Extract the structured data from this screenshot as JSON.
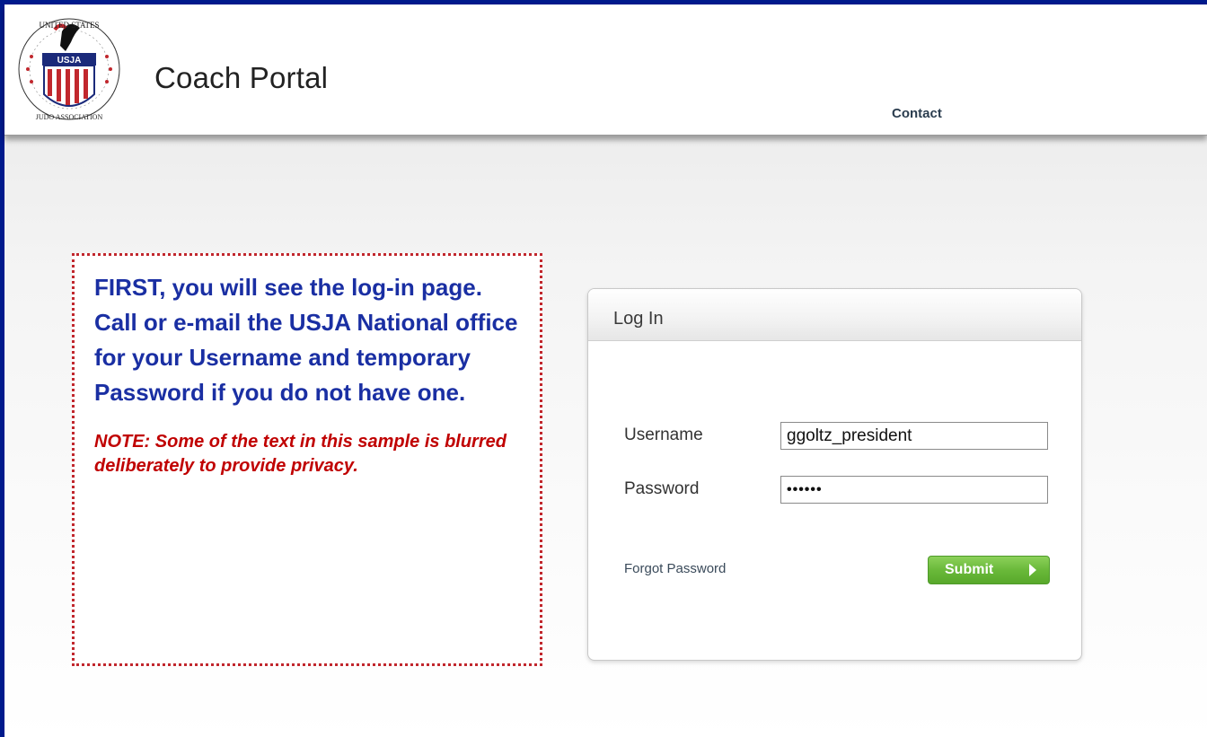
{
  "header": {
    "title": "Coach Portal",
    "nav_contact": "Contact",
    "logo_icon": "usja-seal-icon",
    "logo_text_top": "UNITED STATES",
    "logo_text_bottom": "JUDO ASSOCIATION",
    "logo_badge": "USJA"
  },
  "callout": {
    "main_text": "FIRST, you will see the log-in page.  Call or e-mail the USJA National office for your Username and temporary Password if you do not have one.",
    "note_text": "NOTE:  Some of the text in this sample is blurred deliberately to provide privacy.",
    "border_color": "#c1272d",
    "text_color": "#1a2fa3",
    "note_color": "#c00000"
  },
  "login": {
    "title": "Log In",
    "username_label": "Username",
    "username_value": "ggoltz_president",
    "password_label": "Password",
    "password_value": "••••••",
    "forgot_link": "Forgot Password",
    "submit_label": "Submit",
    "submit_icon": "chevron-right-icon",
    "submit_color": "#6ab93a"
  },
  "frame_color": "#001a8c"
}
